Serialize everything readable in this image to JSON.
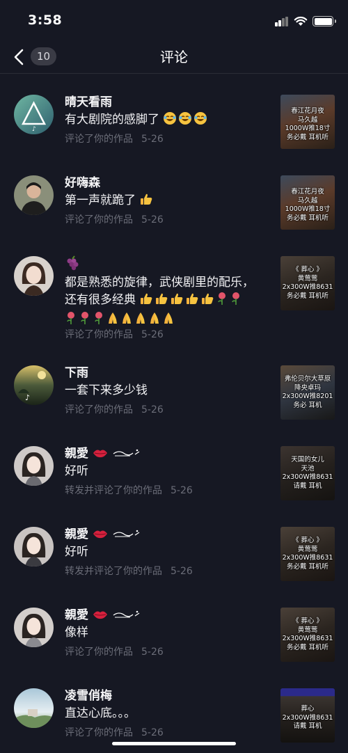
{
  "status_bar": {
    "time": "3:58"
  },
  "header": {
    "title": "评论",
    "unread_count": "10"
  },
  "comments": [
    {
      "user": "晴天看雨",
      "text": "有大剧院的感脚了",
      "action": "评论了你的作品",
      "date": "5-26",
      "thumb_lines": [
        "春江花月夜",
        "马久越",
        "1000W推18寸",
        "务必戴 耳机听"
      ]
    },
    {
      "user": "好嗨森",
      "text": "第一声就跪了",
      "action": "评论了你的作品",
      "date": "5-26",
      "thumb_lines": [
        "春江花月夜",
        "马久越",
        "1000W推18寸",
        "务必戴 耳机听"
      ]
    },
    {
      "user": "",
      "text_line1": "都是熟悉的旋律，武侠剧里的配乐，",
      "text_line2": "还有很多经典",
      "action": "评论了你的作品",
      "date": "5-26",
      "thumb_lines": [
        "《 葬心 》",
        "黄莺莺",
        "2x300W推8631",
        "务必戴 耳机听"
      ]
    },
    {
      "user": "下雨",
      "text": "一套下来多少钱",
      "action": "评论了你的作品",
      "date": "5-26",
      "thumb_lines": [
        "弗伦贝尔大草原",
        "降央卓玛",
        "2x300W推8201",
        "务必 耳机"
      ]
    },
    {
      "user": "親愛",
      "text": "好听",
      "action": "转发并评论了你的作品",
      "date": "5-26",
      "thumb_lines": [
        "天国的女儿",
        "天池",
        "2x300W推8631",
        "请戴 耳机"
      ]
    },
    {
      "user": "親愛",
      "text": "好听",
      "action": "转发并评论了你的作品",
      "date": "5-26",
      "thumb_lines": [
        "《 葬心 》",
        "黄莺莺",
        "2x300W推8631",
        "务必戴 耳机听"
      ]
    },
    {
      "user": "親愛",
      "text": "像样",
      "action": "评论了你的作品",
      "date": "5-26",
      "thumb_lines": [
        "《 葬心 》",
        "黄莺莺",
        "2x300W推8631",
        "务必戴 耳机听"
      ]
    },
    {
      "user": "凌雪俏梅",
      "text": "直达心底。。。",
      "action": "评论了你的作品",
      "date": "5-26",
      "thumb_lines": [
        "葬心",
        "2x300W推8631",
        "请戴 耳机"
      ]
    }
  ],
  "colors": {
    "background": "#161823",
    "secondary_text": "#6b6d78",
    "badge": "#3a3b45"
  },
  "icons": [
    "back-chevron-icon",
    "signal-icon",
    "wifi-icon",
    "battery-icon",
    "laugh-cry-emoji",
    "thumbs-up-emoji",
    "rose-emoji",
    "pray-hands-emoji",
    "grapes-emoji",
    "lips-emoji",
    "tiktok-logo-icon"
  ]
}
